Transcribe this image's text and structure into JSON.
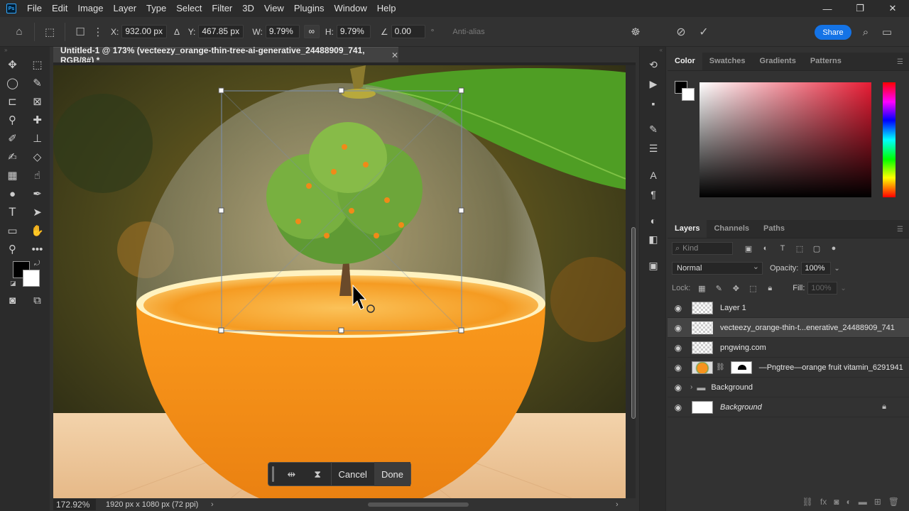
{
  "menu": [
    "File",
    "Edit",
    "Image",
    "Layer",
    "Type",
    "Select",
    "Filter",
    "3D",
    "View",
    "Plugins",
    "Window",
    "Help"
  ],
  "app_logo": "Ps",
  "window_controls": [
    "—",
    "❐",
    "✕"
  ],
  "options": {
    "x_label": "X:",
    "x_value": "932.00 px",
    "y_label": "Y:",
    "y_value": "467.85 px",
    "w_label": "W:",
    "w_value": "9.79%",
    "h_label": "H:",
    "h_value": "9.79%",
    "angle_value": "0.00",
    "angle_unit": "°",
    "antialias_label": "Anti-alias",
    "share_label": "Share"
  },
  "document": {
    "tab_title": "Untitled-1 @ 173% (vecteezy_orange-thin-tree-ai-generative_24488909_741, RGB/8#) *",
    "zoom": "172.92%",
    "size_info": "1920 px x 1080 px (72 ppi)"
  },
  "transform_bar": {
    "cancel_label": "Cancel",
    "done_label": "Done"
  },
  "color_panel": {
    "tabs": [
      "Color",
      "Swatches",
      "Gradients",
      "Patterns"
    ],
    "active_tab": "Color",
    "foreground": "#000000",
    "background": "#ffffff",
    "hue_color": "#e81c34"
  },
  "layers_panel": {
    "tabs": [
      "Layers",
      "Channels",
      "Paths"
    ],
    "kind_placeholder": "Kind",
    "blend_mode": "Normal",
    "opacity_label": "Opacity:",
    "opacity_value": "100%",
    "lock_label": "Lock:",
    "fill_label": "Fill:",
    "fill_value": "100%",
    "layers": [
      {
        "name": "Layer 1"
      },
      {
        "name": "vecteezy_orange-thin-t...enerative_24488909_741",
        "selected": true
      },
      {
        "name": "pngwing.com"
      },
      {
        "name": "—Pngtree—orange fruit vitamin_6291941"
      },
      {
        "name": "Background",
        "group": true
      },
      {
        "name": "Background",
        "locked": true
      }
    ]
  }
}
